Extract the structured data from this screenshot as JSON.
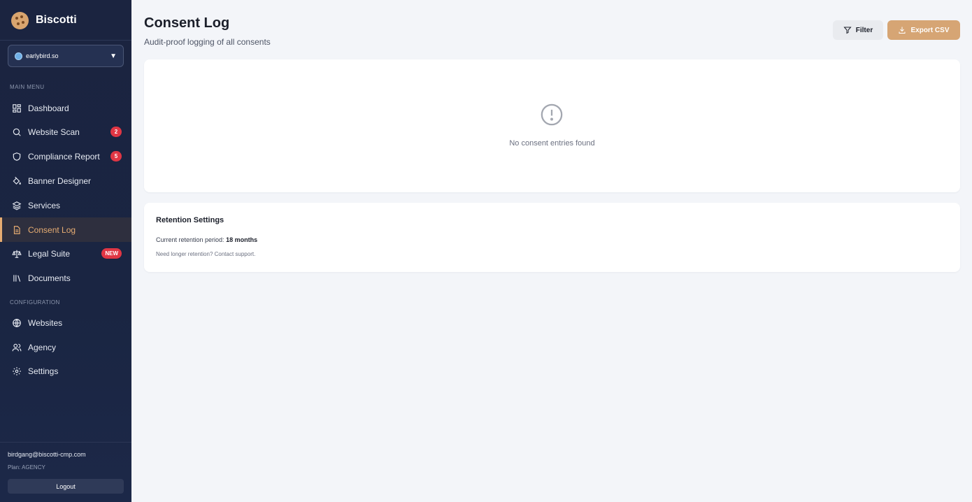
{
  "sidebar": {
    "brand": "Biscotti",
    "site_selector": {
      "value": "earlybird.so"
    },
    "sections": {
      "main_menu": "MAIN MENU",
      "configuration": "CONFIGURATION"
    },
    "main_items": [
      {
        "label": "Dashboard",
        "icon": "dashboard-grid-icon"
      },
      {
        "label": "Website Scan",
        "icon": "search-icon",
        "badge": "2"
      },
      {
        "label": "Compliance Report",
        "icon": "shield-icon",
        "badge": "5"
      },
      {
        "label": "Banner Designer",
        "icon": "paint-bucket-icon"
      },
      {
        "label": "Services",
        "icon": "layers-icon"
      },
      {
        "label": "Consent Log",
        "icon": "document-icon",
        "active": true
      },
      {
        "label": "Legal Suite",
        "icon": "scales-icon",
        "badge": "NEW"
      },
      {
        "label": "Documents",
        "icon": "library-icon"
      }
    ],
    "config_items": [
      {
        "label": "Websites",
        "icon": "globe-icon"
      },
      {
        "label": "Agency",
        "icon": "users-icon"
      },
      {
        "label": "Settings",
        "icon": "gear-icon"
      }
    ],
    "user": {
      "email": "birdgang@biscotti-cmp.com",
      "plan": "Plan: AGENCY",
      "logout_label": "Logout"
    }
  },
  "header": {
    "title": "Consent Log",
    "subtitle": "Audit-proof logging of all consents",
    "filter_label": "Filter",
    "export_label": "Export CSV"
  },
  "empty_state": {
    "icon": "alert-circle-icon",
    "message": "No consent entries found"
  },
  "retention": {
    "title": "Retention Settings",
    "period_label": "Current retention period:",
    "period_value": "18 months",
    "note": "Need longer retention? Contact support."
  },
  "colors": {
    "accent": "#d6a574",
    "sidebar_bg": "#1b2440",
    "badge": "#e03644"
  }
}
